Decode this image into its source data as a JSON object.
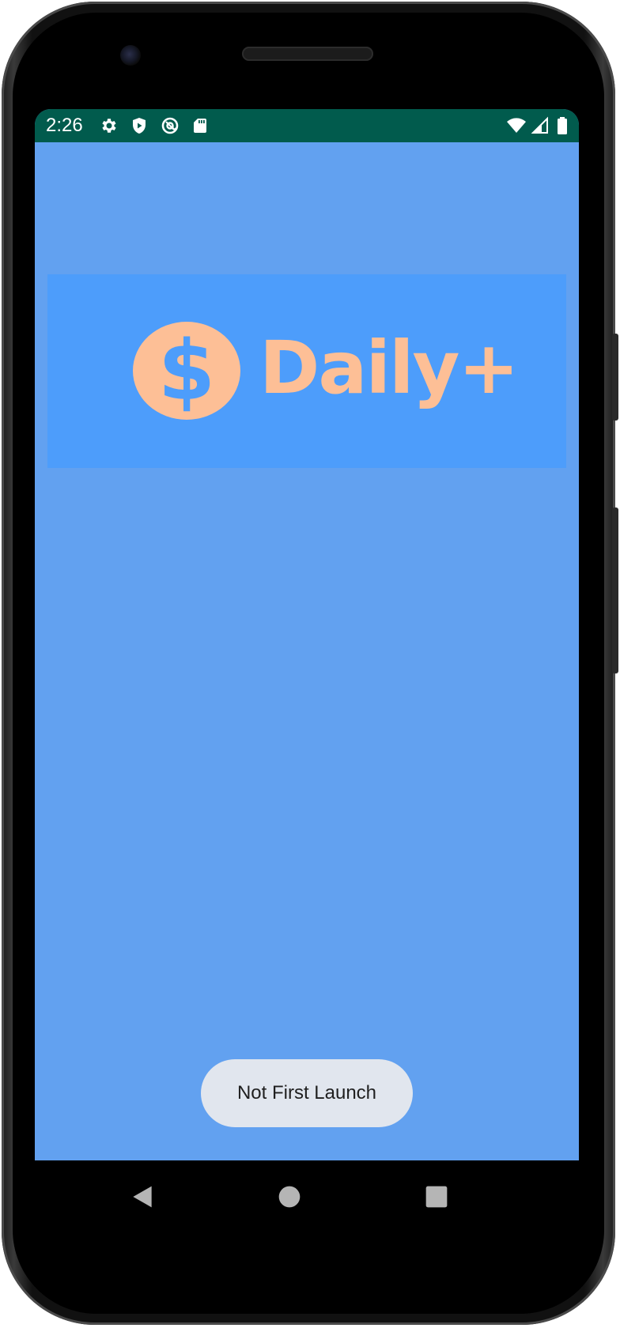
{
  "status_bar": {
    "time": "2:26",
    "left_icons": [
      "gear-icon",
      "shield-play-icon",
      "at-sync-icon",
      "sd-card-icon"
    ],
    "right_icons": [
      "wifi-icon",
      "cell-signal-icon",
      "battery-icon"
    ],
    "background_color": "#015b4d"
  },
  "app": {
    "background_color": "#62a1f0",
    "logo": {
      "text": "Daily+",
      "symbol": "$",
      "banner_color": "#4d9dfb",
      "accent_color": "#fdbf96"
    }
  },
  "toast": {
    "message": "Not First Launch"
  },
  "nav_bar": {
    "buttons": [
      "back-icon",
      "home-icon",
      "recents-icon"
    ]
  }
}
